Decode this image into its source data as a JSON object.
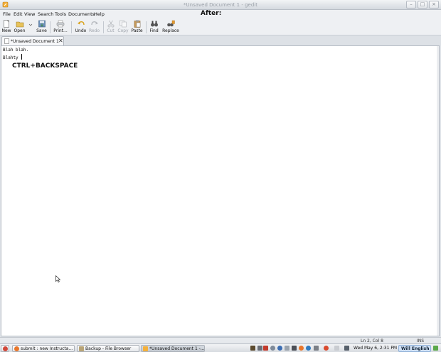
{
  "window": {
    "title": "*Unsaved Document 1 - gedit"
  },
  "annotation_heading": "After:",
  "menu": [
    "File",
    "Edit",
    "View",
    "Search",
    "Tools",
    "Documents",
    "Help"
  ],
  "toolbar": {
    "new": "New",
    "open": "Open",
    "save": "Save",
    "print": "Print...",
    "undo": "Undo",
    "redo": "Redo",
    "cut": "Cut",
    "copy": "Copy",
    "paste": "Paste",
    "find": "Find",
    "replace": "Replace"
  },
  "tab": {
    "label": "*Unsaved Document 1"
  },
  "editor": {
    "lines": [
      "Blah blah.",
      "Blahty "
    ],
    "overlay_text": "CTRL+BACKSPACE"
  },
  "statusbar": {
    "position": "Ln 2, Col 8",
    "mode": "INS"
  },
  "taskbar": {
    "items": [
      "submit : new Instructa...",
      "Backup - File Browser",
      "*Unsaved Document 1 -..."
    ],
    "clock": "Wed May  6,  2:31 PM",
    "user": "Will English"
  },
  "colors": {
    "accent": "#2a6bb0",
    "editor_bg": "#ffffff",
    "chrome_bg": "#eef0f3"
  }
}
